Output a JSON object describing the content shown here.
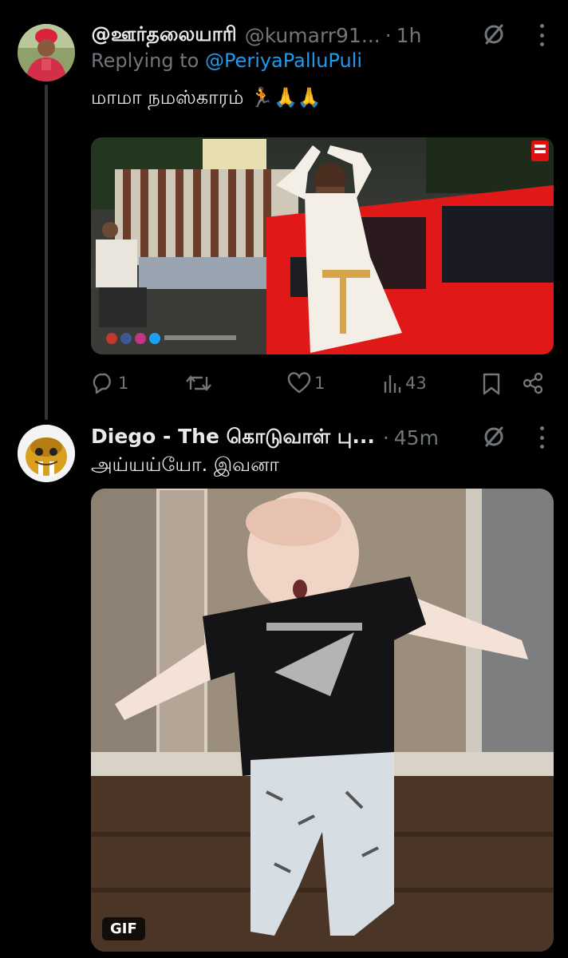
{
  "tweets": [
    {
      "author_name": "@ஊர்தலையாரி",
      "handle": "@kumarr91...",
      "separator": "·",
      "time": "1h",
      "replying_label": "Replying to ",
      "replying_to": "@PeriyaPalluPuli",
      "text": "மாமா நமஸ்காரம் 🏃🙏🙏",
      "actions": {
        "replies": "1",
        "retweets": "",
        "likes": "1",
        "views": "43"
      }
    },
    {
      "author_name": "Diego - The கொடுவாள் பு...",
      "separator": "·",
      "time": "45m",
      "text": "அய்யய்யோ. இவனா",
      "gif_label": "GIF"
    }
  ],
  "icons": {
    "grok": "grok-slash-icon",
    "more": "more-vertical-icon",
    "reply": "reply-icon",
    "retweet": "retweet-icon",
    "like": "heart-icon",
    "views": "views-chart-icon",
    "bookmark": "bookmark-icon",
    "share": "share-icon"
  },
  "colors": {
    "background": "#000000",
    "text_primary": "#e7e9ea",
    "text_secondary": "#71767b",
    "link": "#1d9bf0",
    "thread_line": "#333639"
  }
}
